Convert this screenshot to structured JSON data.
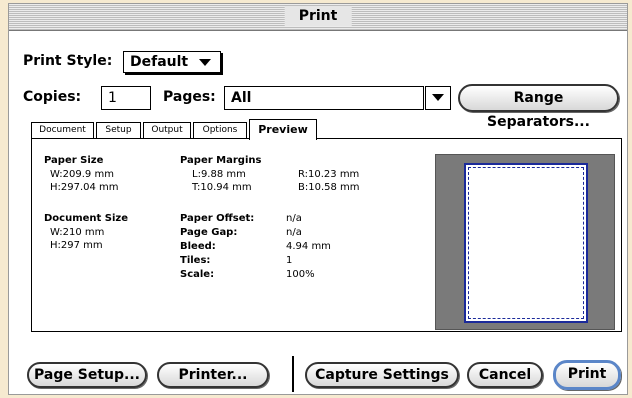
{
  "window": {
    "title": "Print"
  },
  "print_style": {
    "label": "Print Style:",
    "value": "Default"
  },
  "copies": {
    "label": "Copies:",
    "value": "1"
  },
  "pages": {
    "label": "Pages:",
    "value": "All"
  },
  "range_separators_label": "Range Separators...",
  "tabs": [
    {
      "label": "Document",
      "active": false
    },
    {
      "label": "Setup",
      "active": false
    },
    {
      "label": "Output",
      "active": false
    },
    {
      "label": "Options",
      "active": false
    },
    {
      "label": "Preview",
      "active": true
    }
  ],
  "preview": {
    "paper_size": {
      "label": "Paper Size",
      "width": "W:209.9 mm",
      "height": "H:297.04 mm"
    },
    "paper_margins": {
      "label": "Paper Margins",
      "left": "L:9.88 mm",
      "right": "R:10.23 mm",
      "top": "T:10.94 mm",
      "bottom": "B:10.58 mm"
    },
    "document_size": {
      "label": "Document Size",
      "width": "W:210 mm",
      "height": "H:297 mm"
    },
    "details": [
      {
        "label": "Paper Offset:",
        "value": "n/a"
      },
      {
        "label": "Page Gap:",
        "value": "n/a"
      },
      {
        "label": "Bleed:",
        "value": "4.94 mm"
      },
      {
        "label": "Tiles:",
        "value": "1"
      },
      {
        "label": "Scale:",
        "value": "100%"
      }
    ]
  },
  "buttons": {
    "page_setup": "Page Setup...",
    "printer": "Printer...",
    "capture_settings": "Capture Settings",
    "cancel": "Cancel",
    "print": "Print"
  },
  "colors": {
    "background": "#f6ead0",
    "preview_backdrop": "#7a7a7a",
    "page_border": "#1b2a9a",
    "default_button_ring": "#5b86c8"
  },
  "icons": {
    "dropdown": "triangle-down-icon"
  }
}
